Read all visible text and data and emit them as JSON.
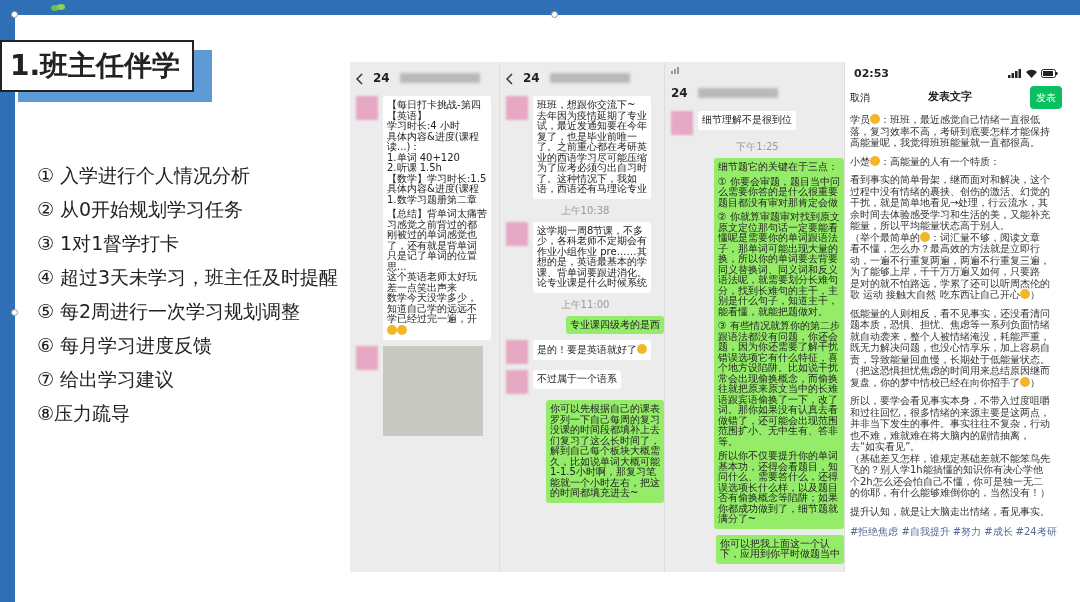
{
  "title": "1.班主任伴学",
  "items": [
    "① 入学进行个人情况分析",
    "② 从0开始规划学习任务",
    "③ 1对1督学打卡",
    "④ 超过3天未学习，班主任及时提醒",
    "⑤ 每2周进行一次学习规划调整",
    "⑥ 每月学习进度反馈",
    "⑦ 给出学习建议",
    "⑧压力疏导"
  ],
  "chats": [
    {
      "header": "24",
      "status_bar": false,
      "messages": [
        {
          "kind": "in",
          "paragraphs": [
            [
              "【每日打卡挑战-第四",
              "【英语】",
              "学习时长:4 小时",
              "具体内容&进度(课程",
              "读...)：",
              "1.单词 40+120",
              "2.听课 1.5h",
              "【数学】学习时长:1.5",
              "具体内容&进度(课程",
              "1.数学习题册第二章"
            ],
            [
              "【总结】背单词太痛苦",
              "习感觉之前背过的都",
              "刚被过的单词感觉也",
              "了，还有就是背单词",
              "只是记了单词的位置",
              "思...",
              "这个英语老师太好玩",
              "差一点笑出声来",
              "数学今天没学多少，",
              "知道自己学的远远不",
              "学已经过完一遍，开",
              [
                {
                  "kind": "emoji"
                },
                {
                  "kind": "emoji"
                }
              ]
            ]
          ]
        },
        {
          "kind": "photo"
        }
      ]
    },
    {
      "header": "24",
      "status_bar": false,
      "messages": [
        {
          "kind": "in",
          "paragraphs": [
            [
              "班班，想跟你交流下~",
              "去年因为疫情延期了专业",
              "试，最近发通知要在今年",
              "复了，也是毕业前唯一",
              "了。之前重心都在考研英",
              "业的西语学习尽可能压缩",
              "为了应考必须匀出自习时",
              "了。这种情况下，我如",
              "语，西语还有马理论专业"
            ]
          ]
        },
        {
          "kind": "time",
          "text": "上午10:38"
        },
        {
          "kind": "in",
          "paragraphs": [
            [
              "这学期一周8节课，不多",
              "少，各科老师不定期会有",
              "作业小组作业 pre……其",
              "想的是，英语最基本的学",
              "课、背单词要跟进消化。",
              "论专业课是什么时候系统"
            ]
          ]
        },
        {
          "kind": "time",
          "text": "上午11:00"
        },
        {
          "kind": "out",
          "paragraphs": [
            [
              "专业课四级考的是西"
            ]
          ]
        },
        {
          "kind": "in",
          "paragraphs": [
            [
              [
                "是的！要是英语就好了",
                {
                  "kind": "emoji"
                }
              ]
            ]
          ]
        },
        {
          "kind": "in",
          "paragraphs": [
            [
              "不过属于一个语系"
            ]
          ]
        },
        {
          "kind": "out",
          "paragraphs": [
            [
              "你可以先根据自己的课表",
              "罗列一下自己每周的复习",
              "没课的时间段都填补上去",
              "们复习了这么长时间了，",
              "解到自己每个板块大概需",
              "久，比如说单词大概可能",
              "1-1.5小时啊，那复习笔",
              "能就一个小时左右，把这",
              "的时间都填充进去~"
            ]
          ]
        }
      ]
    },
    {
      "header": "24",
      "status_bar": true,
      "messages": [
        {
          "kind": "in",
          "paragraphs": [
            [
              "细节理解不是很到位"
            ]
          ]
        },
        {
          "kind": "time",
          "text": "下午1:25"
        },
        {
          "kind": "out",
          "paragraphs": [
            [
              "细节题它的关键在于三点："
            ],
            [
              "① 你要会审题，题目当中问",
              "么需要你答的是什么很重要",
              "题目都没有审对那肯定会做"
            ],
            [
              "② 你就算审题审对找到原文",
              "原文定位那句话一定要能看",
              "懂呢是需要你的单词跟语法",
              "子，那单词可能出现大量的",
              "换，所以你的单词要去背要",
              "同义替换词、同义词和反义",
              "语法呢，就需要划分长难句",
              "分，找到长难句的主干，主",
              "别是什么句子，知道主干，",
              "能看懂，就能把题做对。"
            ],
            [
              "③ 有些情况就算你的第二步",
              "跟语法都没有问题，你还会",
              "题，因为你还需要了解干扰",
              "错误选项它有什么特征，喜",
              "个地方设陷阱。比如说干扰",
              "常会出现偷换概念，而偷换",
              "往就把原来原文当中的长难",
              "语跟宾语偷换了一下，改了",
              "词。那你如果没有认真去看",
              "做错了，还可能会出现范围",
              "范围扩小、无中生有、答非",
              "等。"
            ],
            [
              "所以你不仅要提升你的单词",
              "基本功，还得会看题目，知",
              "问什么、需要答什么，还得",
              "误选项长什么样，以及题目",
              "否有偷换概念等陷阱；如果",
              "你都成功做到了，细节题就",
              "满分了~"
            ]
          ]
        },
        {
          "kind": "out",
          "paragraphs": [
            [
              "你可以把我上面这一个认",
              "下，应用到你平时做题当中"
            ]
          ]
        }
      ]
    }
  ],
  "post": {
    "time": "02:53",
    "cancel": "取消",
    "heading": "发表文字",
    "publish": "发表",
    "paragraphs": [
      [
        [
          "学员",
          {
            "kind": "emoji"
          },
          "：班班，最近感觉自己情绪一直很低"
        ],
        "落，复习效率不高，考研到底要怎样才能保持",
        "高能量呢，我觉得班班能量就一直都很高。"
      ],
      [
        [
          "小楚",
          {
            "kind": "emoji"
          },
          "：高能量的人有一个特质："
        ]
      ],
      [
        "看到事实的简单骨架，继而面对和解决，这个",
        "过程中没有情绪的裹挟、创伤的激活、幻觉的",
        "干扰，就是简单地看见→处理，行云流水，其",
        "余时间去体验感受学习和生活的美，又能补充",
        "能量，所以平均能量状态高于别人。",
        [
          "（举个最简单的",
          {
            "kind": "emoji"
          },
          "：词汇量不够，阅读文章"
        ],
        "看不懂，怎么办？最高效的方法就是立即行",
        "动，一遍不行重复两遍，两遍不行重复三遍，",
        "为了能够上岸，千千万万遍又如何，只要路",
        "是对的就不怕路远，学累了还可以听周杰伦的",
        [
          "歌 运动 接触大自然 吃东西让自己开心",
          {
            "kind": "emoji"
          },
          "）"
        ]
      ],
      [
        "低能量的人则相反，看不见事实，还没看清问",
        "题本质，恐惧、担忧、焦虑等一系列负面情绪",
        "就自动袭来，整个人被情绪淹没，耗能严重，",
        "既无力解决问题，也没心情享乐，加上容易自",
        "责，导致能量回血慢，长期处于低能量状态。",
        "（把这恐惧担忧焦虑的时间用来总结原因继而",
        [
          "复盘，你的梦中情校已经在向你招手了",
          {
            "kind": "emoji"
          },
          "）"
        ]
      ],
      [
        "所以，要学会看见事实本身，不带入过度咀嚼",
        "和过往回忆，很多情绪的来源主要是这两点，",
        "并非当下发生的事件。事实往往不复杂，行动",
        "也不难，难就难在将大脑内的剧情抽离，",
        "去“如实看见”。",
        "（基础差又怎样，谁规定基础差就不能笨鸟先",
        "飞的？别人学1h能搞懂的知识你有决心学他",
        "个2h怎么还会怕自己不懂，你可是独一无二",
        "的你耶，有什么能够难倒你的，当然没有！）"
      ],
      [
        "提升认知，就是让大脑走出情绪，看见事实。"
      ]
    ],
    "tags": [
      "#拒绝焦虑",
      "#自我提升",
      "#努力",
      "#成长",
      "#24考研"
    ]
  }
}
